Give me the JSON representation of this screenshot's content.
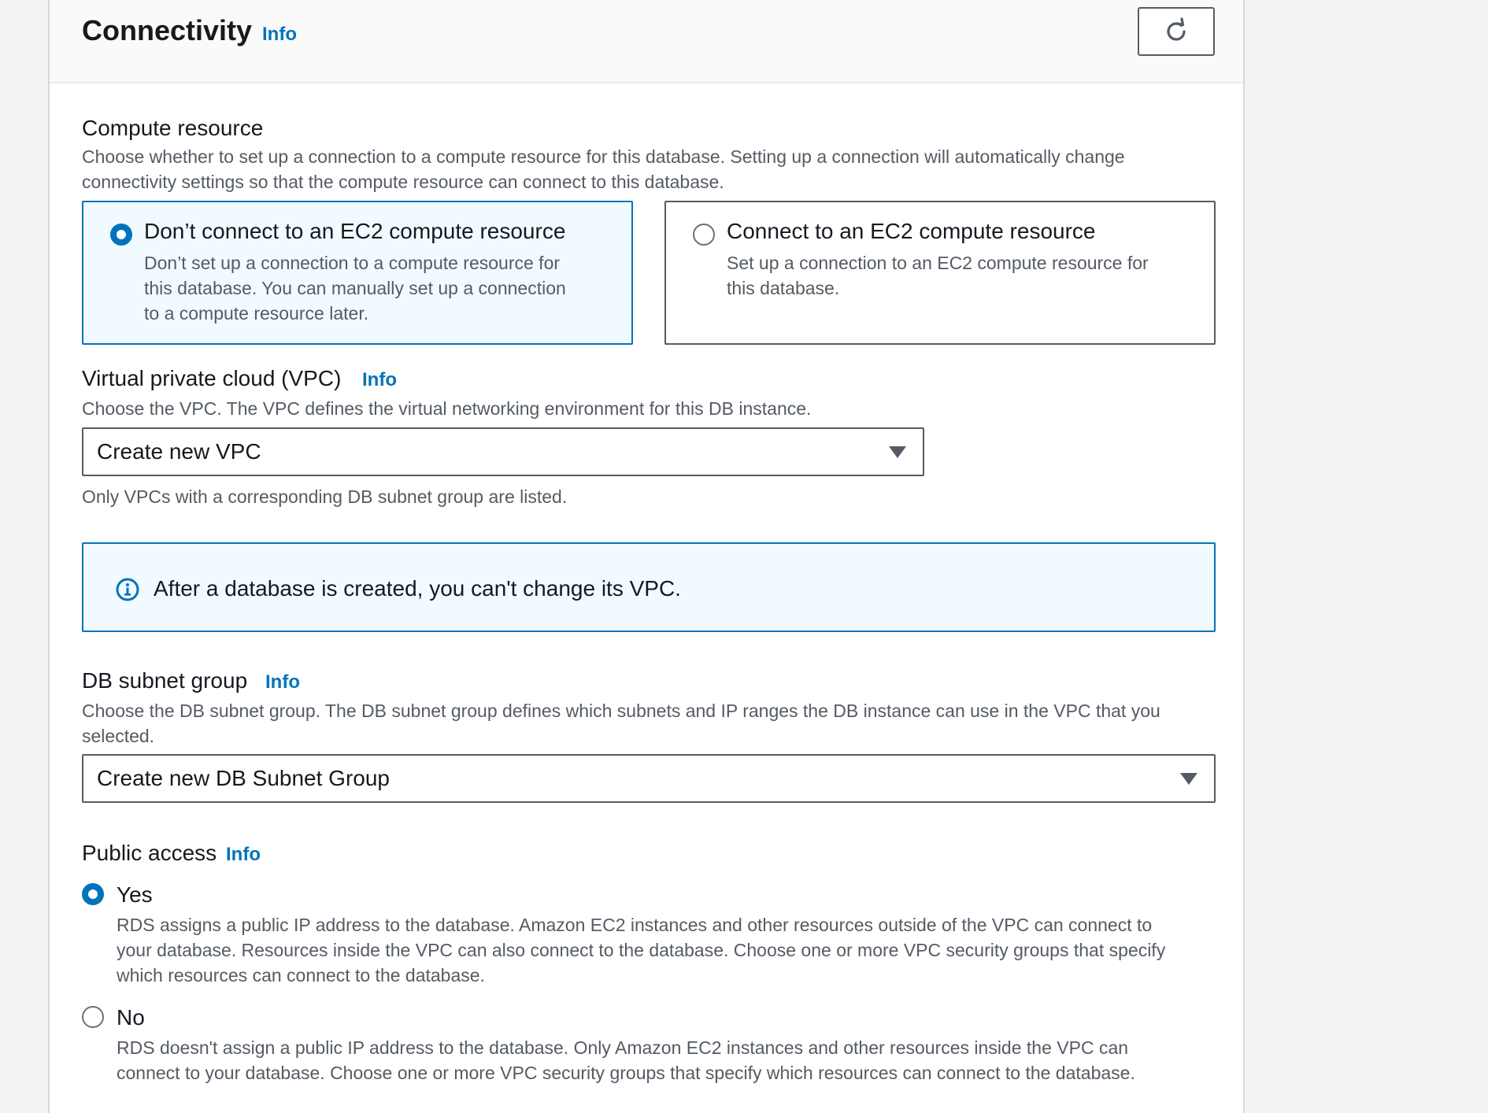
{
  "header": {
    "title": "Connectivity",
    "info_label": "Info",
    "refresh_icon": "refresh-icon"
  },
  "compute": {
    "label": "Compute resource",
    "description_line1": "Choose whether to set up a connection to a compute resource for this database. Setting up a connection will automatically change",
    "description_line2": "connectivity settings so that the compute resource can connect to this database.",
    "options": [
      {
        "title": "Don’t connect to an EC2 compute resource",
        "desc_line1": "Don’t set up a connection to a compute resource for",
        "desc_line2": "this database. You can manually set up a connection",
        "desc_line3": "to a compute resource later.",
        "selected": true
      },
      {
        "title": "Connect to an EC2 compute resource",
        "desc_line1": "Set up a connection to an EC2 compute resource for",
        "desc_line2": "this database.",
        "selected": false
      }
    ]
  },
  "vpc": {
    "label": "Virtual private cloud (VPC)",
    "info_label": "Info",
    "description": "Choose the VPC. The VPC defines the virtual networking environment for this DB instance.",
    "selected_value": "Create new VPC",
    "hint": "Only VPCs with a corresponding DB subnet group are listed."
  },
  "alert": {
    "text": "After a database is created, you can't change its VPC.",
    "icon": "info-circle-icon",
    "color": "#0073bb"
  },
  "subnet": {
    "label": "DB subnet group",
    "info_label": "Info",
    "description_line1": "Choose the DB subnet group. The DB subnet group defines which subnets and IP ranges the DB instance can use in the VPC that you",
    "description_line2": "selected.",
    "selected_value": "Create new DB Subnet Group"
  },
  "public_access": {
    "label": "Public access",
    "info_label": "Info",
    "options": [
      {
        "label": "Yes",
        "desc_line1": "RDS assigns a public IP address to the database. Amazon EC2 instances and other resources outside of the VPC can connect to",
        "desc_line2": "your database. Resources inside the VPC can also connect to the database. Choose one or more VPC security groups that specify",
        "desc_line3": "which resources can connect to the database.",
        "selected": true
      },
      {
        "label": "No",
        "desc_line1": "RDS doesn't assign a public IP address to the database. Only Amazon EC2 instances and other resources inside the VPC can",
        "desc_line2": "connect to your database. Choose one or more VPC security groups that specify which resources can connect to the database.",
        "selected": false
      }
    ]
  },
  "colors": {
    "accent": "#0073bb",
    "border": "#545b64",
    "text": "#16191f",
    "muted": "#545b64"
  }
}
